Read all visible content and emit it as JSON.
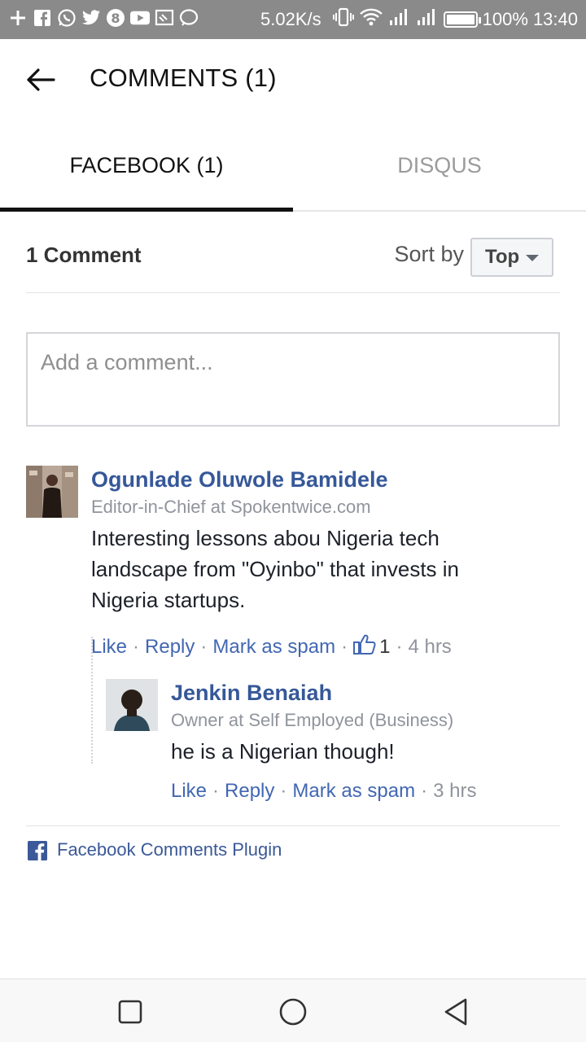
{
  "status_bar": {
    "net_speed": "5.02K/s",
    "battery": "100%",
    "time": "13:40",
    "notification_icons": [
      "plus-icon",
      "facebook-icon",
      "whatsapp-icon",
      "twitter-icon",
      "app-icon",
      "youtube-icon",
      "cast-icon",
      "chat-icon"
    ]
  },
  "header": {
    "title": "COMMENTS (1)"
  },
  "tabs": [
    {
      "label": "FACEBOOK (1)",
      "active": true
    },
    {
      "label": "DISQUS",
      "active": false
    }
  ],
  "plugin": {
    "count_label": "1 Comment",
    "sort_by_label": "Sort by",
    "sort_value": "Top",
    "input_placeholder": "Add a comment...",
    "footer_link": "Facebook Comments Plugin"
  },
  "comments": [
    {
      "name": "Ogunlade Oluwole Bamidele",
      "subtitle": "Editor-in-Chief at Spokentwice.com",
      "text": "Interesting lessons abou Nigeria tech landscape from \"Oyinbo\" that invests in Nigeria startups.",
      "actions": {
        "like": "Like",
        "reply": "Reply",
        "spam": "Mark as spam"
      },
      "like_count": "1",
      "time": "4 hrs",
      "replies": [
        {
          "name": "Jenkin Benaiah",
          "subtitle": "Owner at Self Employed (Business)",
          "text": "he is a Nigerian though!",
          "actions": {
            "like": "Like",
            "reply": "Reply",
            "spam": "Mark as spam"
          },
          "time": "3 hrs"
        }
      ]
    }
  ],
  "colors": {
    "link": "#4267b2",
    "name": "#365899",
    "status_bar": "#8a8a8a"
  }
}
